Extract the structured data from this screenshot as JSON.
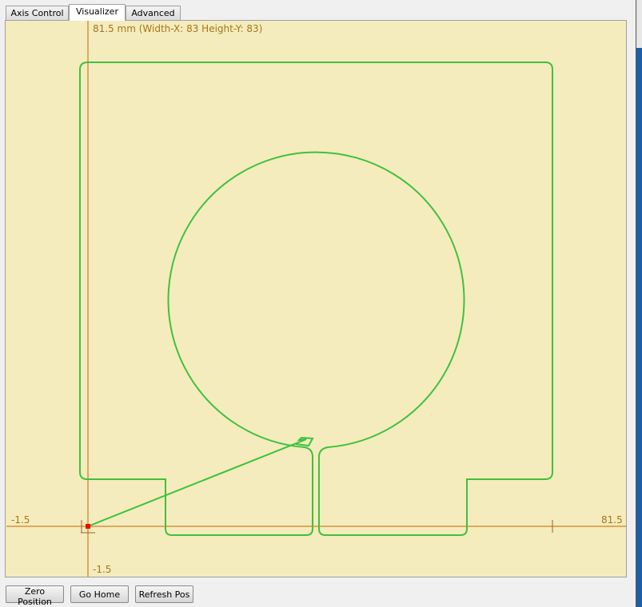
{
  "tabs": [
    {
      "label": "Axis Control"
    },
    {
      "label": "Visualizer"
    },
    {
      "label": "Advanced"
    }
  ],
  "active_tab": "Visualizer",
  "visualizer": {
    "size_label": "81.5 mm  (Width-X: 83  Height-Y: 83)",
    "x_min_label": "-1.5",
    "x_max_label": "81.5",
    "y_min_label": "-1.5",
    "colors": {
      "background": "#f4ecbc",
      "axis": "#c86400",
      "toolpath": "#40c040",
      "position": "#ff0000"
    }
  },
  "buttons": {
    "zero": "Zero Position",
    "home": "Go Home",
    "refresh": "Refresh Pos"
  }
}
